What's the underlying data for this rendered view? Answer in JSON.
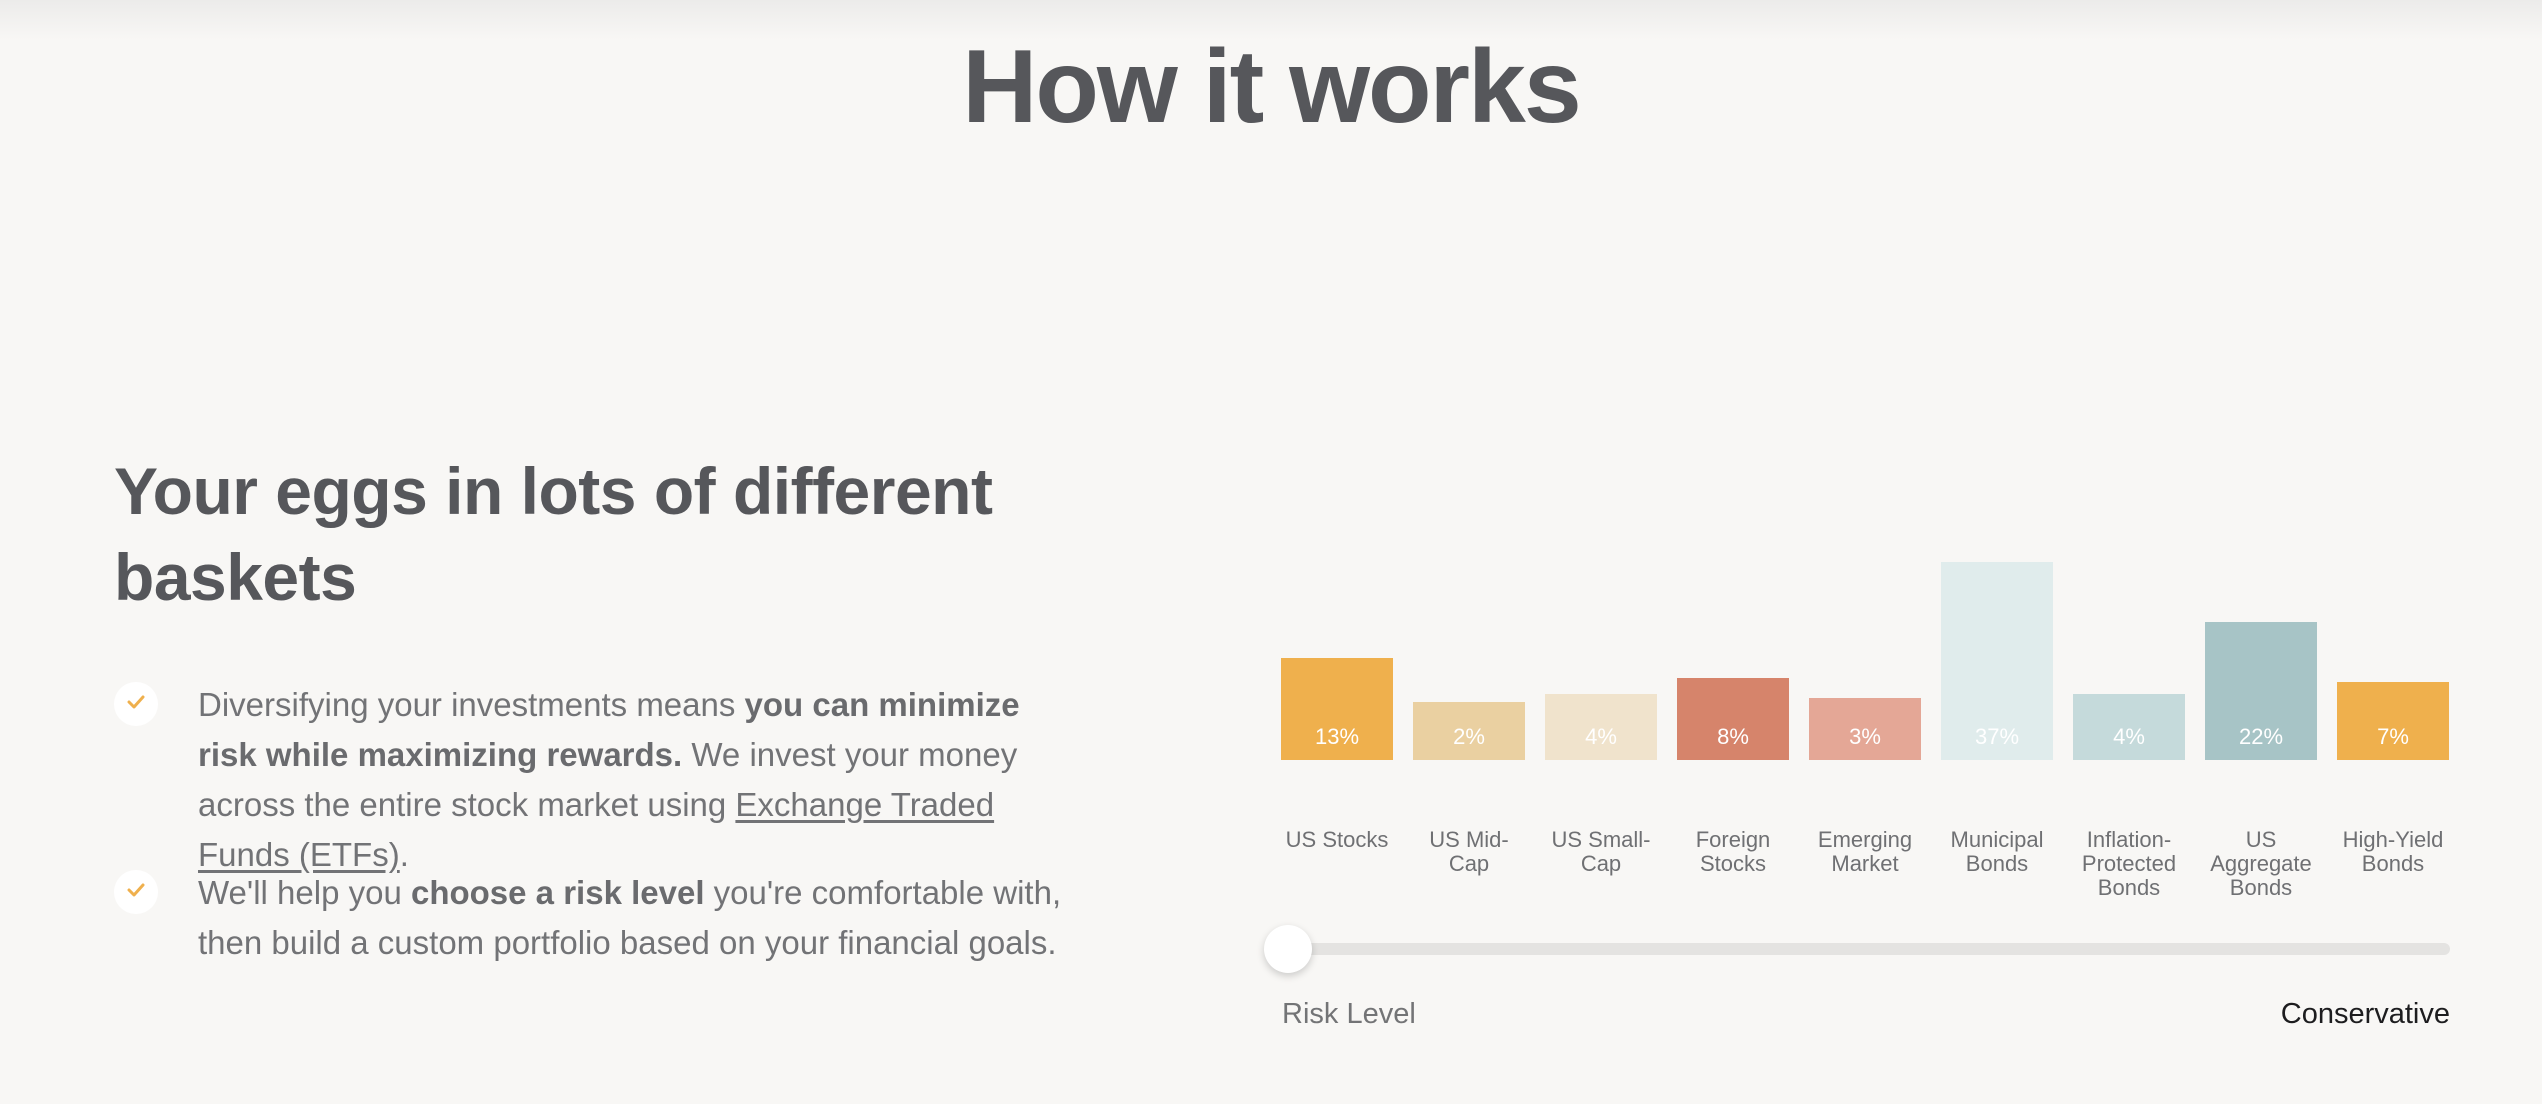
{
  "page": {
    "title": "How it works"
  },
  "section": {
    "heading": "Your eggs in lots of different baskets",
    "bullets": [
      {
        "icon": "check-icon",
        "text_before": "Diversifying your investments means ",
        "bold": "you can minimize risk while maximizing rewards.",
        "text_middle": " We invest your money across the entire stock market using ",
        "link": "Exchange Traded Funds (ETFs)",
        "text_after": "."
      },
      {
        "icon": "check-icon",
        "text_before": "We'll help you ",
        "bold": "choose a risk level",
        "text_after": " you're comfortable with, then build a custom portfolio based on your financial goals."
      }
    ]
  },
  "colors": {
    "accent": "#efb04d",
    "heading": "#56575b",
    "background": "#f8f7f5"
  },
  "chart_data": {
    "type": "bar",
    "title": "",
    "xlabel": "",
    "ylabel": "",
    "categories": [
      "US Stocks",
      "US Mid-Cap",
      "US Small-Cap",
      "Foreign Stocks",
      "Emerging Market",
      "Municipal Bonds",
      "Inflation-Protected Bonds",
      "US Aggregate Bonds",
      "High-Yield Bonds"
    ],
    "label_lines": [
      [
        "US Stocks"
      ],
      [
        "US Mid-",
        "Cap"
      ],
      [
        "US Small-",
        "Cap"
      ],
      [
        "Foreign",
        "Stocks"
      ],
      [
        "Emerging",
        "Market"
      ],
      [
        "Municipal",
        "Bonds"
      ],
      [
        "Inflation-",
        "Protected",
        "Bonds"
      ],
      [
        "US",
        "Aggregate",
        "Bonds"
      ],
      [
        "High-Yield",
        "Bonds"
      ]
    ],
    "values": [
      13,
      2,
      4,
      8,
      3,
      37,
      4,
      22,
      7
    ],
    "value_labels": [
      "13%",
      "2%",
      "4%",
      "8%",
      "3%",
      "37%",
      "4%",
      "22%",
      "7%"
    ],
    "unit": "%",
    "colors": [
      "#efb04d",
      "#ead0a1",
      "#f0e3cc",
      "#d6846b",
      "#e4a796",
      "#e0ecec",
      "#c5dadb",
      "#a7c4c6",
      "#efb04d"
    ],
    "grid": false,
    "legend": "none"
  },
  "slider": {
    "label": "Risk Level",
    "value_label": "Conservative",
    "value_fraction": 0
  }
}
